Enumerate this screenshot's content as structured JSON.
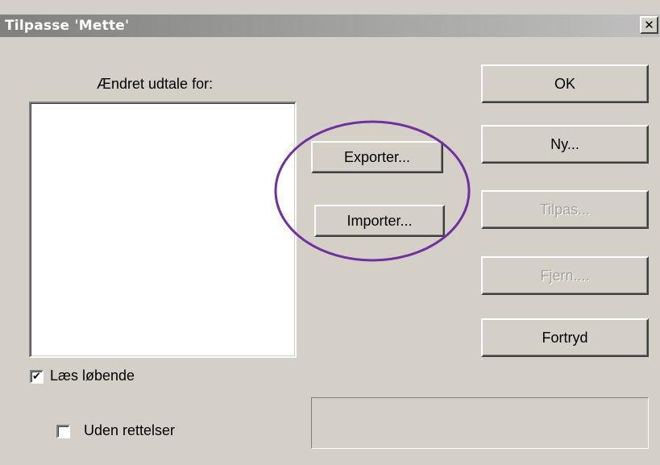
{
  "window": {
    "title": "Tilpasse 'Mette'",
    "close_glyph": "✕"
  },
  "list": {
    "label": "Ændret udtale for:",
    "items": []
  },
  "buttons": {
    "ok": "OK",
    "ny": "Ny...",
    "tilpas": "Tilpas...",
    "fjern": "Fjern....",
    "fortryd": "Fortryd",
    "exporter": "Exporter...",
    "importer": "Importer..."
  },
  "options": {
    "laes_lobende": {
      "label": "Læs løbende",
      "checked": true
    },
    "uden_rettelser": {
      "label": "Uden rettelser",
      "checked": false
    }
  },
  "annotation": {
    "color": "#7030a0",
    "icon": "highlight-ellipse"
  }
}
